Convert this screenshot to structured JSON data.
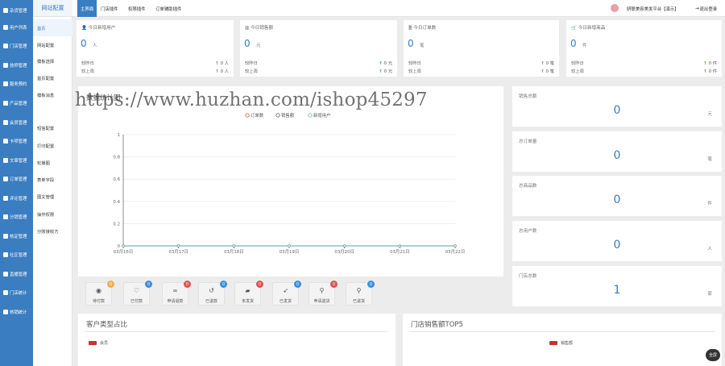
{
  "sidebar": {
    "items": [
      {
        "label": "杂货管理"
      },
      {
        "label": "用户列表"
      },
      {
        "label": "门店管理"
      },
      {
        "label": "技师管理"
      },
      {
        "label": "服务预约"
      },
      {
        "label": "产品管理"
      },
      {
        "label": "会员管理"
      },
      {
        "label": "卡项管理"
      },
      {
        "label": "文章管理"
      },
      {
        "label": "订单管理"
      },
      {
        "label": "评论管理"
      },
      {
        "label": "分销管理"
      },
      {
        "label": "核定管理"
      },
      {
        "label": "社区管理"
      },
      {
        "label": "直播管理"
      },
      {
        "label": "门店统计"
      },
      {
        "label": "核销统计"
      }
    ]
  },
  "submenu": {
    "title": "网站配置",
    "items": [
      {
        "label": "首页"
      },
      {
        "label": "网站配置"
      },
      {
        "label": "模板选择"
      },
      {
        "label": "首页配置"
      },
      {
        "label": "模板消息"
      },
      {
        "label": "短信配置"
      },
      {
        "label": "打印配置"
      },
      {
        "label": "轮播图"
      },
      {
        "label": "表单字段"
      },
      {
        "label": "图文管理"
      },
      {
        "label": "操作权限"
      },
      {
        "label": "分账接收方"
      }
    ]
  },
  "topbar": {
    "tabs": [
      {
        "label": "主界面"
      },
      {
        "label": "门店插件"
      },
      {
        "label": "权限插件"
      },
      {
        "label": "订单辅助插件"
      }
    ],
    "user": "妍联美容美发平台【演示】",
    "logout": "退出登录"
  },
  "stats": [
    {
      "title": "今日新增用户",
      "value": "0",
      "unit": "人",
      "yesterday_label": "较昨日",
      "yesterday": "0 人",
      "lastweek_label": "较上周",
      "lastweek": "0 人",
      "icon": "user-icon"
    },
    {
      "title": "今日销售额",
      "value": "0",
      "unit": "元",
      "yesterday_label": "较昨日",
      "yesterday": "0 元",
      "lastweek_label": "较上周",
      "lastweek": "0 元",
      "icon": "bar-chart-icon"
    },
    {
      "title": "今日订单数",
      "value": "0",
      "unit": "笔",
      "yesterday_label": "较昨日",
      "yesterday": "0 笔",
      "lastweek_label": "较上周",
      "lastweek": "0 笔",
      "icon": "file-icon"
    },
    {
      "title": "今日新增商品",
      "value": "0",
      "unit": "件",
      "yesterday_label": "较昨日",
      "yesterday": "0 件",
      "lastweek_label": "较上周",
      "lastweek": "0 件",
      "icon": "cart-icon"
    }
  ],
  "totals": [
    {
      "label": "销售总额",
      "value": "0",
      "unit": "元"
    },
    {
      "label": "总订单量",
      "value": "0",
      "unit": "笔"
    },
    {
      "label": "总商品数",
      "value": "0",
      "unit": "件"
    },
    {
      "label": "总用户数",
      "value": "0",
      "unit": "人"
    },
    {
      "label": "门店总数",
      "value": "1",
      "unit": "家"
    }
  ],
  "order_status": [
    {
      "label": "待付款",
      "count": "0",
      "badge_color": "#f0ad4e",
      "icon": "eye-icon"
    },
    {
      "label": "已付款",
      "count": "0",
      "badge_color": "#3a8ed8",
      "icon": "heart-icon"
    },
    {
      "label": "申请退款",
      "count": "0",
      "badge_color": "#d9534f",
      "icon": "link-icon"
    },
    {
      "label": "已退款",
      "count": "0",
      "badge_color": "#3a8ed8",
      "icon": "undo-icon"
    },
    {
      "label": "未发货",
      "count": "0",
      "badge_color": "#d9534f",
      "icon": "truck-icon"
    },
    {
      "label": "已发货",
      "count": "0",
      "badge_color": "#3a8ed8",
      "icon": "rocket-icon"
    },
    {
      "label": "申请退货",
      "count": "0",
      "badge_color": "#d9534f",
      "icon": "bike-icon"
    },
    {
      "label": "已退货",
      "count": "0",
      "badge_color": "#3a8ed8",
      "icon": "bike-icon"
    }
  ],
  "bottom": {
    "left_title": "客户类型占比",
    "left_legend": [
      "会员"
    ],
    "right_title": "门店销售额TOP5",
    "right_legend": [
      "销售额"
    ]
  },
  "watermark": "https://www.huzhan.com/ishop45297",
  "fab_label": "全屏",
  "colors": {
    "primary": "#3a7dc0",
    "up": "#3aa83a",
    "legend_red": "#c23531"
  },
  "chart_data": {
    "type": "line",
    "title": "数据统计图",
    "x": [
      "03月16日",
      "03月17日",
      "03月18日",
      "03月19日",
      "03月20日",
      "03月21日",
      "03月22日"
    ],
    "series": [
      {
        "name": "订单数",
        "values": [
          0,
          0,
          0,
          0,
          0,
          0,
          0
        ],
        "color": "#c23531"
      },
      {
        "name": "销售额",
        "values": [
          0,
          0,
          0,
          0,
          0,
          0,
          0
        ],
        "color": "#2f4554"
      },
      {
        "name": "新增用户",
        "values": [
          0,
          0,
          0,
          0,
          0,
          0,
          0
        ],
        "color": "#61a0a8"
      }
    ],
    "yticks": [
      "0",
      "0.2",
      "0.4",
      "0.6",
      "0.8",
      "1"
    ],
    "ylim": [
      0,
      1
    ],
    "grid": true
  }
}
